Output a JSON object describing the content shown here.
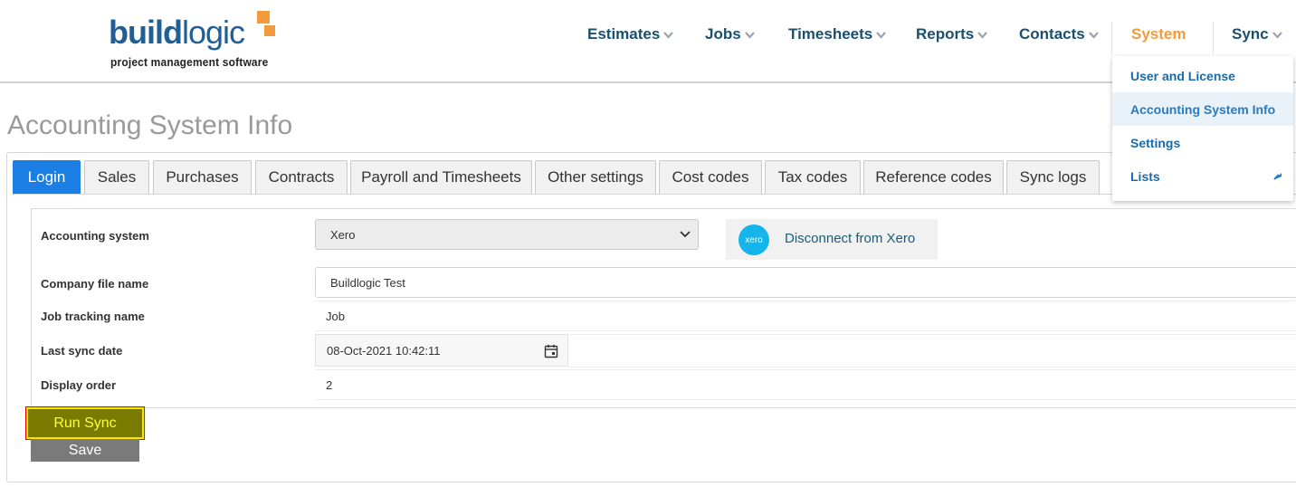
{
  "app": {
    "logo_word_bold": "build",
    "logo_word_light": "logic",
    "logo_subtitle": "project management software"
  },
  "nav": {
    "items": [
      {
        "label": "Estimates"
      },
      {
        "label": "Jobs"
      },
      {
        "label": "Timesheets"
      },
      {
        "label": "Reports"
      },
      {
        "label": "Contacts"
      },
      {
        "label": "System"
      },
      {
        "label": "Sync"
      }
    ],
    "active_color": "#f29a3c",
    "text_color": "#1a4f6e"
  },
  "system_menu": {
    "items": [
      {
        "label": "User and License"
      },
      {
        "label": "Accounting System Info"
      },
      {
        "label": "Settings"
      },
      {
        "label": "Lists"
      }
    ]
  },
  "page": {
    "title": "Accounting System Info"
  },
  "tabs": [
    {
      "label": "Login"
    },
    {
      "label": "Sales"
    },
    {
      "label": "Purchases"
    },
    {
      "label": "Contracts"
    },
    {
      "label": "Payroll and Timesheets"
    },
    {
      "label": "Other settings"
    },
    {
      "label": "Cost codes"
    },
    {
      "label": "Tax codes"
    },
    {
      "label": "Reference codes"
    },
    {
      "label": "Sync logs"
    }
  ],
  "form": {
    "accounting_system": {
      "label": "Accounting system",
      "value": "Xero"
    },
    "xero_button": {
      "logo_text": "xero",
      "label": "Disconnect from Xero"
    },
    "company_file_name": {
      "label": "Company file name",
      "value": "Buildlogic Test"
    },
    "job_tracking_name": {
      "label": "Job tracking name",
      "value": "Job"
    },
    "last_sync_date": {
      "label": "Last sync date",
      "value": "08-Oct-2021 10:42:11"
    },
    "display_order": {
      "label": "Display order",
      "value": "2"
    }
  },
  "buttons": {
    "run_sync": "Run Sync",
    "save": "Save"
  },
  "colors": {
    "accent_blue": "#1a7ee5",
    "xero_blue": "#13b5ea",
    "run_sync_bg": "#7a7a00",
    "run_sync_text": "#ffff33"
  }
}
